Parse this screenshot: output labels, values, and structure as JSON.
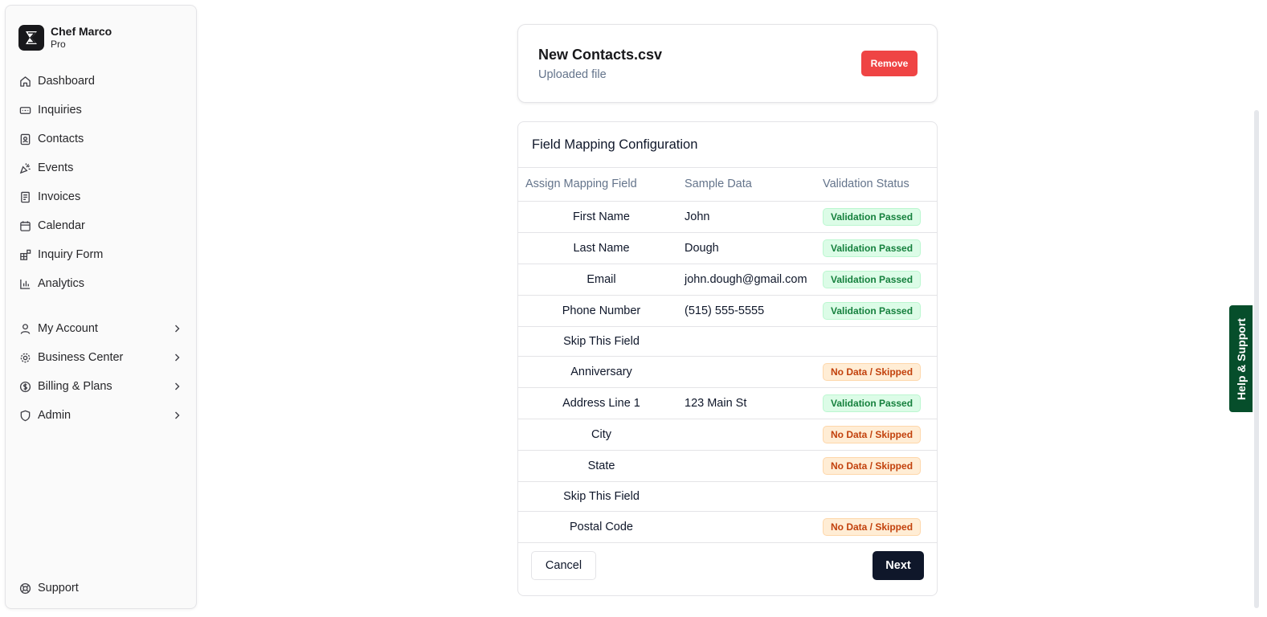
{
  "sidebar": {
    "brand": {
      "name": "Chef Marco",
      "plan": "Pro"
    },
    "items": [
      {
        "label": "Dashboard",
        "icon": "home-icon"
      },
      {
        "label": "Inquiries",
        "icon": "inbox-icon"
      },
      {
        "label": "Contacts",
        "icon": "contact-card-icon"
      },
      {
        "label": "Events",
        "icon": "party-popper-icon"
      },
      {
        "label": "Invoices",
        "icon": "receipt-icon"
      },
      {
        "label": "Calendar",
        "icon": "calendar-icon"
      },
      {
        "label": "Inquiry Form",
        "icon": "form-blocks-icon"
      },
      {
        "label": "Analytics",
        "icon": "bar-chart-icon"
      }
    ],
    "groups": [
      {
        "label": "My Account",
        "icon": "user-icon"
      },
      {
        "label": "Business Center",
        "icon": "gear-icon"
      },
      {
        "label": "Billing & Plans",
        "icon": "dollar-circle-icon"
      },
      {
        "label": "Admin",
        "icon": "shield-icon"
      }
    ],
    "support": {
      "label": "Support",
      "icon": "lifebuoy-icon"
    }
  },
  "file_card": {
    "file_name": "New Contacts.csv",
    "subtitle": "Uploaded file",
    "remove_label": "Remove"
  },
  "mapping": {
    "title": "Field Mapping Configuration",
    "columns": [
      "Assign Mapping Field",
      "Sample Data",
      "Validation Status"
    ],
    "rows": [
      {
        "field": "First Name",
        "sample": "John",
        "status": "Validation Passed"
      },
      {
        "field": "Last Name",
        "sample": "Dough",
        "status": "Validation Passed"
      },
      {
        "field": "Email",
        "sample": "john.dough@gmail.com",
        "status": "Validation Passed"
      },
      {
        "field": "Phone Number",
        "sample": "(515) 555-5555",
        "status": "Validation Passed"
      },
      {
        "field": "Skip This Field",
        "sample": "",
        "status": ""
      },
      {
        "field": "Anniversary",
        "sample": "",
        "status": "No Data / Skipped"
      },
      {
        "field": "Address Line 1",
        "sample": "123 Main St",
        "status": "Validation Passed"
      },
      {
        "field": "City",
        "sample": "",
        "status": "No Data / Skipped"
      },
      {
        "field": "State",
        "sample": "",
        "status": "No Data / Skipped"
      },
      {
        "field": "Skip This Field",
        "sample": "",
        "status": ""
      },
      {
        "field": "Postal Code",
        "sample": "",
        "status": "No Data / Skipped"
      }
    ],
    "cancel_label": "Cancel",
    "next_label": "Next"
  },
  "help_tab": {
    "label": "Help & Support"
  },
  "colors": {
    "remove_button": "#ef4444",
    "next_button": "#0f172a",
    "badge_pass_bg": "#dcfce7",
    "badge_pass_text": "#15803d",
    "badge_skip_bg": "#ffedd5",
    "badge_skip_text": "#c2410c",
    "help_tab": "#064e2b"
  }
}
